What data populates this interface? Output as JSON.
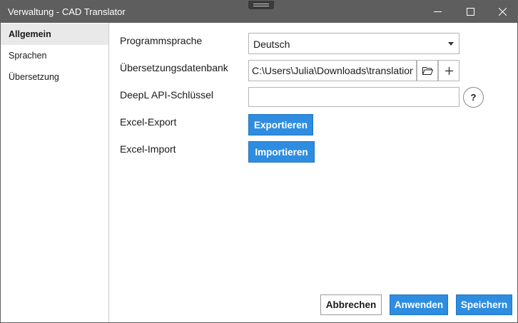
{
  "window": {
    "title": "Verwaltung - CAD Translator"
  },
  "sidebar": {
    "items": [
      {
        "label": "Allgemein",
        "active": true
      },
      {
        "label": "Sprachen",
        "active": false
      },
      {
        "label": "Übersetzung",
        "active": false
      }
    ]
  },
  "general": {
    "language_label": "Programmsprache",
    "language_value": "Deutsch",
    "database_label": "Übersetzungsdatenbank",
    "database_path": "C:\\Users\\Julia\\Downloads\\translation",
    "deepl_label": "DeepL API-Schlüssel",
    "deepl_value": "",
    "help_label": "?",
    "excel_export_label": "Excel-Export",
    "excel_export_button": "Exportieren",
    "excel_import_label": "Excel-Import",
    "excel_import_button": "Importieren"
  },
  "footer": {
    "cancel": "Abbrechen",
    "apply": "Anwenden",
    "save": "Speichern"
  },
  "icons": {
    "minimize": "minimize-icon",
    "maximize": "maximize-icon",
    "close": "close-icon",
    "dropdown": "chevron-down-icon",
    "browse": "folder-open-icon",
    "add": "plus-icon"
  },
  "colors": {
    "titlebar": "#5e5e5e",
    "accent": "#2e8de0",
    "active_nav": "#e9e9e9"
  }
}
